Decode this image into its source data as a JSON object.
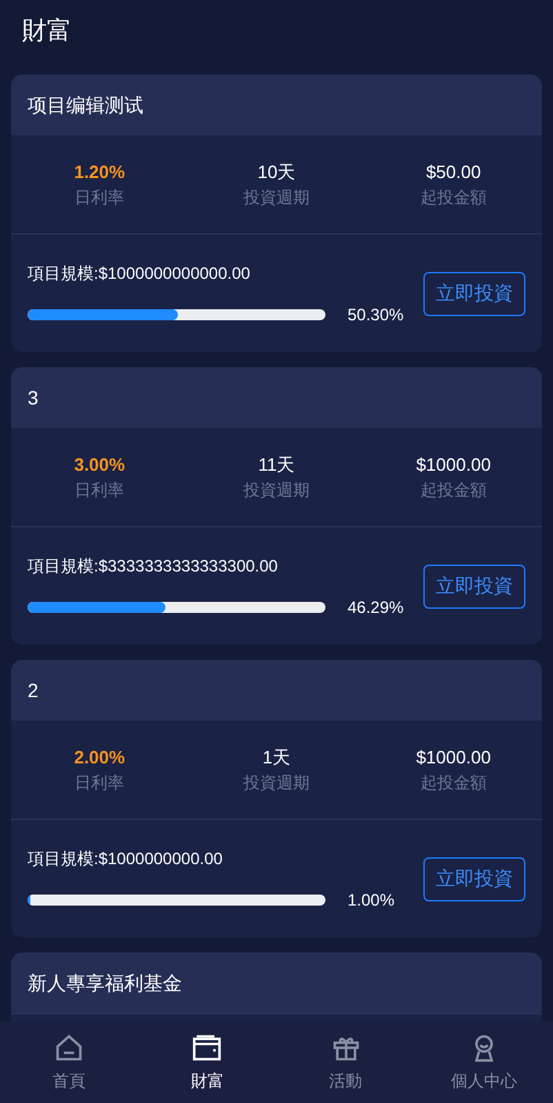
{
  "header": {
    "title": "財富"
  },
  "products": [
    {
      "name": "项目编辑测试",
      "rate": "1.20%",
      "rate_label": "日利率",
      "period": "10天",
      "period_label": "投資週期",
      "min": "$50.00",
      "min_label": "起投金額",
      "scale": "項目規模:$1000000000000.00",
      "level": 0.503,
      "percent": "50.30%",
      "button": "立即投資"
    },
    {
      "name": "3",
      "rate": "3.00%",
      "rate_label": "日利率",
      "period": "11天",
      "period_label": "投資週期",
      "min": "$1000.00",
      "min_label": "起投金額",
      "scale": "項目規模:$3333333333333300.00",
      "level": 0.4629,
      "percent": "46.29%",
      "button": "立即投資"
    },
    {
      "name": "2",
      "rate": "2.00%",
      "rate_label": "日利率",
      "period": "1天",
      "period_label": "投資週期",
      "min": "$1000.00",
      "min_label": "起投金額",
      "scale": "項目規模:$1000000000.00",
      "level": 0.01,
      "percent": "1.00%",
      "button": "立即投資"
    },
    {
      "name": "新人專享福利基金"
    }
  ],
  "tabs": [
    {
      "kind": "home",
      "label": "首頁",
      "selected": false
    },
    {
      "kind": "wallet",
      "label": "財富",
      "selected": true
    },
    {
      "kind": "gift",
      "label": "活動",
      "selected": false
    },
    {
      "kind": "user",
      "label": "個人中心",
      "selected": false
    }
  ]
}
